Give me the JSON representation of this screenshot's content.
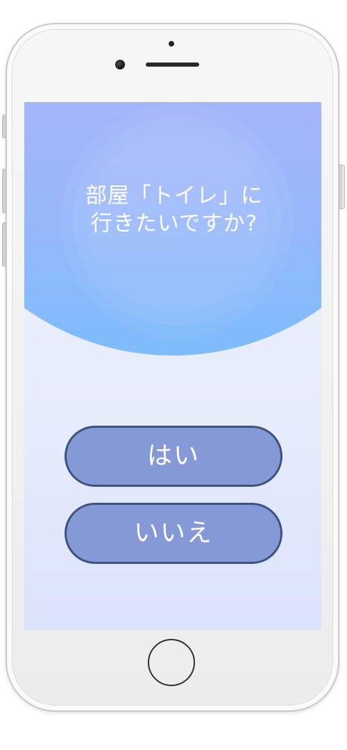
{
  "question": {
    "line1": "部屋「トイレ」に",
    "line2": "行きたいですか?"
  },
  "answers": {
    "yes_label": "はい",
    "no_label": "いいえ"
  },
  "colors": {
    "header_top": "#a7b4fb",
    "header_bottom": "#7ebcfc",
    "button_fill": "#8499d6",
    "button_border": "#3d527f",
    "screen_background": "#eef1fb"
  }
}
